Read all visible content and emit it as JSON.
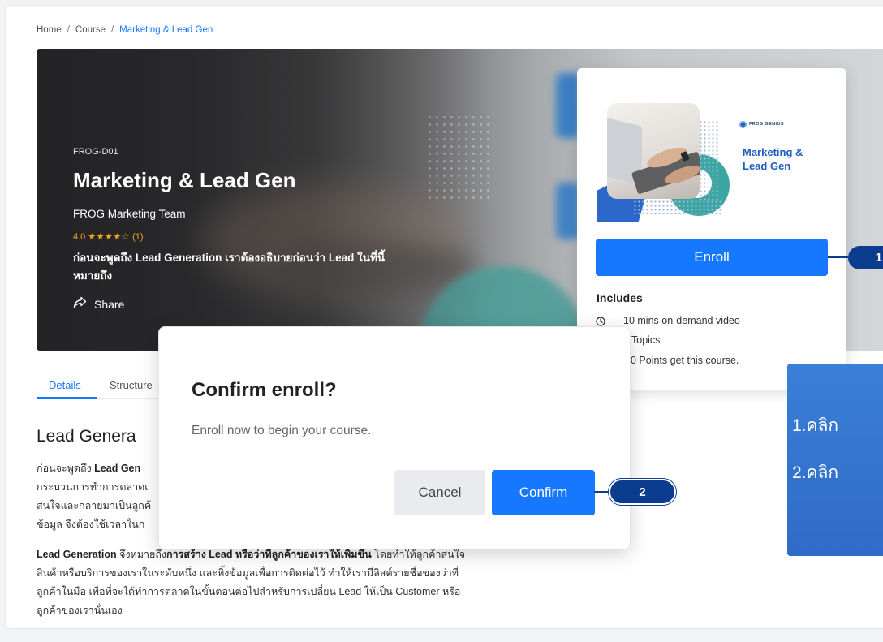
{
  "breadcrumb": {
    "home": "Home",
    "separator": "/",
    "course": "Course",
    "current": "Marketing & Lead Gen"
  },
  "hero": {
    "code": "FROG-D01",
    "title": "Marketing & Lead Gen",
    "team": "FROG Marketing Team",
    "rating": {
      "score": "4.0",
      "stars": "★★★★☆",
      "count": "(1)"
    },
    "description_lines": [
      "ก่อนจะพูดถึง Lead Generation เราต้องอธิบายก่อนว่า Lead ในที่นี้",
      "หมายถึง"
    ],
    "share": {
      "label": "Share",
      "icon": "share-icon"
    }
  },
  "course_card": {
    "thumbnail": {
      "brand": "FROG GENIUS",
      "title_lines": [
        "Marketing &",
        "Lead Gen"
      ]
    },
    "enroll_label": "Enroll",
    "includes_heading": "Includes",
    "includes": [
      {
        "icon": "clock-icon",
        "text": "10 mins on-demand video"
      },
      {
        "text": "Topics"
      },
      {
        "text": "0 Points get this course."
      }
    ]
  },
  "tabs": [
    {
      "label": "Details",
      "active": true
    },
    {
      "label": "Structure",
      "active": false
    }
  ],
  "details": {
    "heading": "Lead Genera",
    "paragraph1": [
      [
        "ก่อนจะพูดถึง ",
        "Lead Gen"
      ],
      [
        "กระบวนการทำการตลาดเ"
      ],
      [
        "สนใจและกลายมาเป็นลูกค้"
      ],
      [
        "ข้อมูล จึงต้องใช้เวลาในก"
      ]
    ],
    "paragraph2": [
      [
        "Lead Generation",
        " จึงหมายถึง",
        "การสร้าง Lead หรือว่าที่ลูกค้าของเราให้เพิ่มขึ้น",
        " โดยทำให้ลูกค้าสนใจ"
      ],
      [
        "สินค้าหรือบริการของเราในระดับหนึ่ง และทิ้งข้อมูลเพื่อการติดต่อไว้ ทำให้เรามีลิสต์รายชื่อของว่าที่"
      ],
      [
        "ลูกค้าในมือ เพื่อที่จะได้ทำการตลาดในขั้นตอนต่อไปสำหรับการเปลี่ยน Lead ให้เป็น Customer หรือ"
      ],
      [
        "ลูกค้าของเรานั่นเอง"
      ]
    ]
  },
  "confirm_modal": {
    "title": "Confirm enroll?",
    "message": "Enroll now to begin your course.",
    "cancel_label": "Cancel",
    "confirm_label": "Confirm"
  },
  "annotations": {
    "step1_badge": "1",
    "step2_badge": "2",
    "instruction_lines": [
      "1.คลิก",
      "2.คลิก"
    ]
  },
  "colors": {
    "accent": "#1677ff",
    "annotation": "#0b3c8e",
    "instruction_panel": "#2f6fcf",
    "rating": "#f5a623"
  }
}
